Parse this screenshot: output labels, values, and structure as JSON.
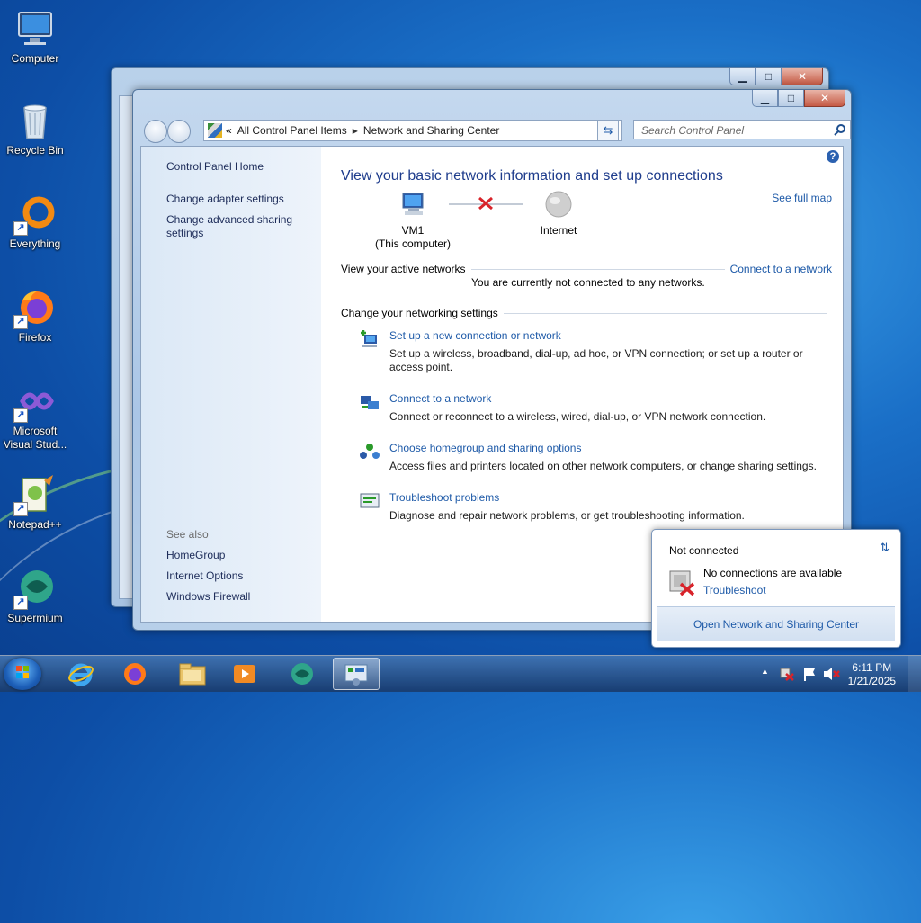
{
  "desktop": {
    "icons": [
      {
        "label": "Computer"
      },
      {
        "label": "Recycle Bin"
      },
      {
        "label": "Everything"
      },
      {
        "label": "Firefox"
      },
      {
        "label": "Microsoft Visual Stud..."
      },
      {
        "label": "Notepad++"
      },
      {
        "label": "Supermium"
      }
    ]
  },
  "window": {
    "breadcrumb": {
      "prefix": "«",
      "item1": "All Control Panel Items",
      "item2": "Network and Sharing Center"
    },
    "search_placeholder": "Search Control Panel",
    "caption": {
      "minimize": "▁",
      "maximize": "□",
      "close": "✕"
    }
  },
  "left_pane": {
    "home": "Control Panel Home",
    "change_adapter": "Change adapter settings",
    "change_advanced": "Change advanced sharing settings",
    "see_also_label": "See also",
    "see_also": [
      "HomeGroup",
      "Internet Options",
      "Windows Firewall"
    ]
  },
  "main": {
    "heading": "View your basic network information and set up connections",
    "see_full_map": "See full map",
    "computer_name": "VM1",
    "computer_sub": "(This computer)",
    "internet_label": "Internet",
    "active_networks_label": "View your active networks",
    "connect_to_network": "Connect to a network",
    "not_connected_msg": "You are currently not connected to any networks.",
    "change_settings_label": "Change your networking settings",
    "tasks": [
      {
        "title": "Set up a new connection or network",
        "desc": "Set up a wireless, broadband, dial-up, ad hoc, or VPN connection; or set up a router or access point."
      },
      {
        "title": "Connect to a network",
        "desc": "Connect or reconnect to a wireless, wired, dial-up, or VPN network connection."
      },
      {
        "title": "Choose homegroup and sharing options",
        "desc": "Access files and printers located on other network computers, or change sharing settings."
      },
      {
        "title": "Troubleshoot problems",
        "desc": "Diagnose and repair network problems, or get troubleshooting information."
      }
    ]
  },
  "flyout": {
    "status": "Not connected",
    "no_conn": "No connections are available",
    "troubleshoot": "Troubleshoot",
    "open_center": "Open Network and Sharing Center"
  },
  "taskbar": {
    "time": "6:11 PM",
    "date": "1/21/2025"
  }
}
